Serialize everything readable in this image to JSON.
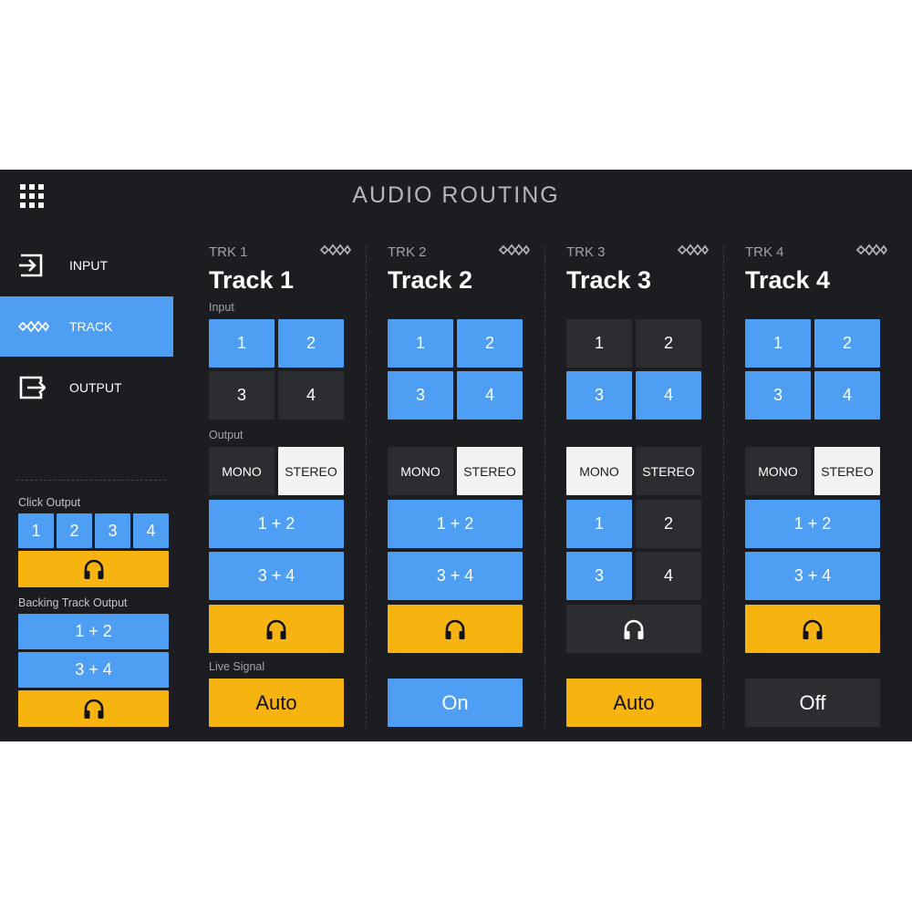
{
  "app": {
    "title": "AUDIO ROUTING"
  },
  "icons": {
    "menu": "grid-menu-icon",
    "input": "login-arrow-icon",
    "track": "diamond-chain-icon",
    "output": "logout-arrow-icon",
    "headphones": "headphones-icon"
  },
  "colors": {
    "background": "#1b1d21",
    "accent_blue": "#4e9ef3",
    "accent_orange": "#f7b310",
    "inactive": "#2c2d31",
    "selected_white": "#f2f2f2"
  },
  "sidebar": {
    "items": [
      {
        "label": "INPUT",
        "active": false
      },
      {
        "label": "TRACK",
        "active": true
      },
      {
        "label": "OUTPUT",
        "active": false
      }
    ],
    "click_output": {
      "label": "Click Output",
      "buttons": [
        {
          "label": "1",
          "active": true
        },
        {
          "label": "2",
          "active": true
        },
        {
          "label": "3",
          "active": true
        },
        {
          "label": "4",
          "active": true
        }
      ],
      "headphones_active": true
    },
    "backing_output": {
      "label": "Backing Track Output",
      "buttons": [
        {
          "label": "1 + 2",
          "active": true
        },
        {
          "label": "3 + 4",
          "active": true
        }
      ],
      "headphones_active": true
    }
  },
  "labels": {
    "input": "Input",
    "output": "Output",
    "live_signal": "Live Signal",
    "mono": "MONO",
    "stereo": "STEREO"
  },
  "tracks": [
    {
      "code": "TRK 1",
      "name": "Track 1",
      "inputs": [
        {
          "label": "1",
          "active": true
        },
        {
          "label": "2",
          "active": true
        },
        {
          "label": "3",
          "active": false
        },
        {
          "label": "4",
          "active": false
        }
      ],
      "mode": "STEREO",
      "outputs": [
        {
          "label": "1 + 2",
          "active": true
        },
        {
          "label": "3 + 4",
          "active": true
        }
      ],
      "headphones_active": true,
      "live_signal": "Auto"
    },
    {
      "code": "TRK 2",
      "name": "Track 2",
      "inputs": [
        {
          "label": "1",
          "active": true
        },
        {
          "label": "2",
          "active": true
        },
        {
          "label": "3",
          "active": true
        },
        {
          "label": "4",
          "active": true
        }
      ],
      "mode": "STEREO",
      "outputs": [
        {
          "label": "1 + 2",
          "active": true
        },
        {
          "label": "3 + 4",
          "active": true
        }
      ],
      "headphones_active": true,
      "live_signal": "On"
    },
    {
      "code": "TRK 3",
      "name": "Track 3",
      "inputs": [
        {
          "label": "1",
          "active": false
        },
        {
          "label": "2",
          "active": false
        },
        {
          "label": "3",
          "active": true
        },
        {
          "label": "4",
          "active": true
        }
      ],
      "mode": "MONO",
      "outputs": [
        {
          "label": "1",
          "active": true
        },
        {
          "label": "2",
          "active": false
        },
        {
          "label": "3",
          "active": true
        },
        {
          "label": "4",
          "active": false
        }
      ],
      "headphones_active": false,
      "live_signal": "Auto"
    },
    {
      "code": "TRK 4",
      "name": "Track 4",
      "inputs": [
        {
          "label": "1",
          "active": true
        },
        {
          "label": "2",
          "active": true
        },
        {
          "label": "3",
          "active": true
        },
        {
          "label": "4",
          "active": true
        }
      ],
      "mode": "STEREO",
      "outputs": [
        {
          "label": "1 + 2",
          "active": true
        },
        {
          "label": "3 + 4",
          "active": true
        }
      ],
      "headphones_active": true,
      "live_signal": "Off"
    }
  ]
}
